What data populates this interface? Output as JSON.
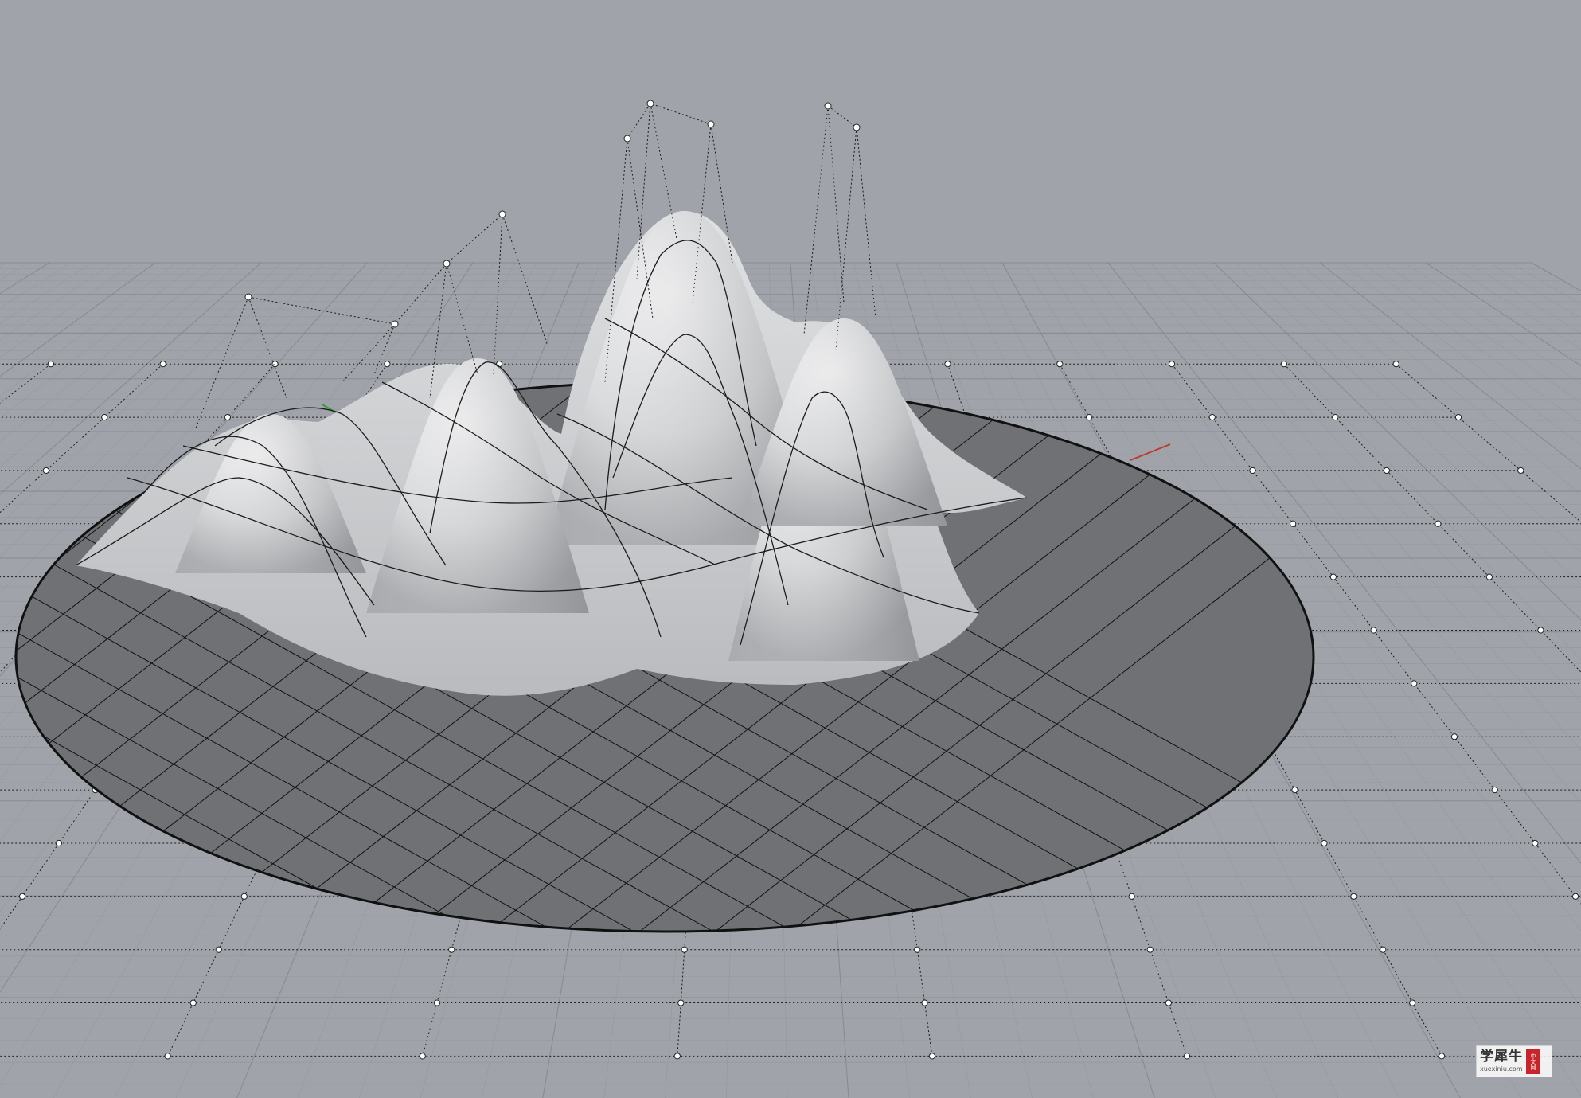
{
  "viewport": {
    "view": "Perspective",
    "background": "#a0a4aa",
    "grid_color": "#8e939a",
    "grid_major_color": "#7c8188",
    "x_axis_color": "#c0392b",
    "y_axis_color": "#3a9a3a"
  },
  "surface": {
    "disc_fill": "#6f7174",
    "disc_rim": "#111111",
    "surface_color": "#e2e3e5",
    "control_point_color": "#ffffff",
    "peak_count": 5
  },
  "watermark": {
    "title": "学犀牛",
    "url": "xuexiniu.com",
    "seal": "中文网"
  }
}
